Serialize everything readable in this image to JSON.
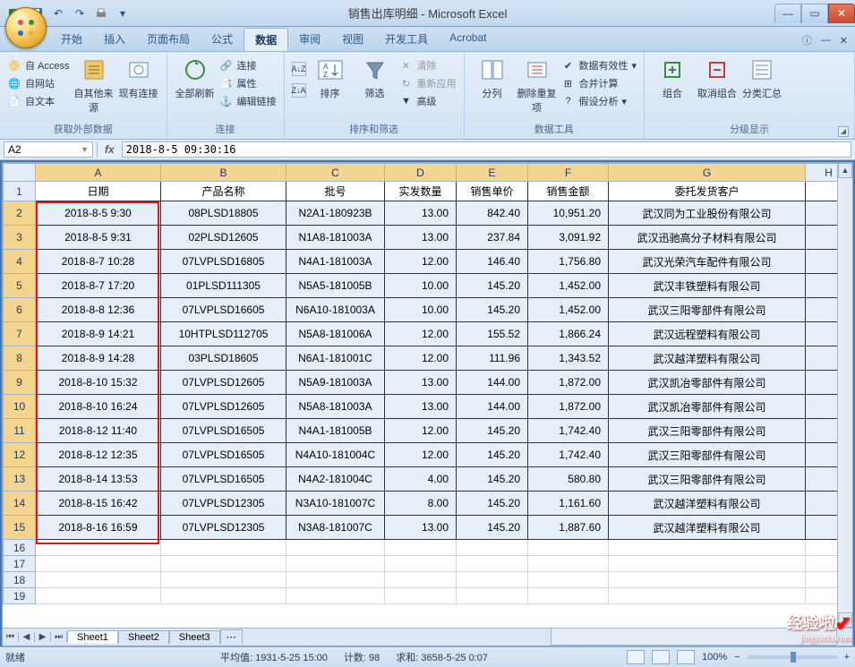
{
  "window": {
    "title": "销售出库明细 - Microsoft Excel"
  },
  "tabs": [
    "开始",
    "插入",
    "页面布局",
    "公式",
    "数据",
    "审阅",
    "视图",
    "开发工具",
    "Acrobat"
  ],
  "activeTab": "数据",
  "ribbon": {
    "g1": {
      "label": "获取外部数据",
      "access": "自 Access",
      "web": "自网站",
      "text": "自文本",
      "other": "自其他来源",
      "existing": "现有连接"
    },
    "g2": {
      "label": "连接",
      "refresh": "全部刷新",
      "conn": "连接",
      "prop": "属性",
      "editlink": "编辑链接"
    },
    "g3": {
      "label": "排序和筛选",
      "sort": "排序",
      "filter": "筛选",
      "clear": "清除",
      "reapply": "重新应用",
      "advanced": "高级"
    },
    "g4": {
      "label": "数据工具",
      "t2c": "分列",
      "dedup": "删除重复项",
      "valid": "数据有效性",
      "consol": "合并计算",
      "whatif": "假设分析"
    },
    "g5": {
      "label": "分级显示",
      "group": "组合",
      "ungroup": "取消组合",
      "subtotal": "分类汇总"
    }
  },
  "formula": {
    "namebox": "A2",
    "value": "2018-8-5  09:30:16"
  },
  "cols": [
    "A",
    "B",
    "C",
    "D",
    "E",
    "F",
    "G",
    "H"
  ],
  "header_row": [
    "日期",
    "产品名称",
    "批号",
    "实发数量",
    "销售单价",
    "销售金额",
    "委托发货客户",
    ""
  ],
  "rows": [
    [
      "2018-8-5 9:30",
      "08PLSD18805",
      "N2A1-180923B",
      "13.00",
      "842.40",
      "10,951.20",
      "武汉同为工业股份有限公司"
    ],
    [
      "2018-8-5 9:31",
      "02PLSD12605",
      "N1A8-181003A",
      "13.00",
      "237.84",
      "3,091.92",
      "武汉迅驰高分子材料有限公司"
    ],
    [
      "2018-8-7 10:28",
      "07LVPLSD16805",
      "N4A1-181003A",
      "12.00",
      "146.40",
      "1,756.80",
      "武汉光荣汽车配件有限公司"
    ],
    [
      "2018-8-7 17:20",
      "01PLSD111305",
      "N5A5-181005B",
      "10.00",
      "145.20",
      "1,452.00",
      "武汉丰铁塑料有限公司"
    ],
    [
      "2018-8-8 12:36",
      "07LVPLSD16605",
      "N6A10-181003A",
      "10.00",
      "145.20",
      "1,452.00",
      "武汉三阳零部件有限公司"
    ],
    [
      "2018-8-9 14:21",
      "10HTPLSD112705",
      "N5A8-181006A",
      "12.00",
      "155.52",
      "1,866.24",
      "武汉远程塑料有限公司"
    ],
    [
      "2018-8-9 14:28",
      "03PLSD18605",
      "N6A1-181001C",
      "12.00",
      "111.96",
      "1,343.52",
      "武汉越洋塑料有限公司"
    ],
    [
      "2018-8-10 15:32",
      "07LVPLSD12605",
      "N5A9-181003A",
      "13.00",
      "144.00",
      "1,872.00",
      "武汉凯冶零部件有限公司"
    ],
    [
      "2018-8-10 16:24",
      "07LVPLSD12605",
      "N5A8-181003A",
      "13.00",
      "144.00",
      "1,872.00",
      "武汉凯冶零部件有限公司"
    ],
    [
      "2018-8-12 11:40",
      "07LVPLSD16505",
      "N4A1-181005B",
      "12.00",
      "145.20",
      "1,742.40",
      "武汉三阳零部件有限公司"
    ],
    [
      "2018-8-12 12:35",
      "07LVPLSD16505",
      "N4A10-181004C",
      "12.00",
      "145.20",
      "1,742.40",
      "武汉三阳零部件有限公司"
    ],
    [
      "2018-8-14 13:53",
      "07LVPLSD16505",
      "N4A2-181004C",
      "4.00",
      "145.20",
      "580.80",
      "武汉三阳零部件有限公司"
    ],
    [
      "2018-8-15 16:42",
      "07LVPLSD12305",
      "N3A10-181007C",
      "8.00",
      "145.20",
      "1,161.60",
      "武汉越洋塑料有限公司"
    ],
    [
      "2018-8-16 16:59",
      "07LVPLSD12305",
      "N3A8-181007C",
      "13.00",
      "145.20",
      "1,887.60",
      "武汉越洋塑料有限公司"
    ]
  ],
  "sheets": [
    "Sheet1",
    "Sheet2",
    "Sheet3"
  ],
  "status": {
    "ready": "就绪",
    "avg_label": "平均值:",
    "avg_val": "1931-5-25 15:00",
    "count_label": "计数:",
    "count_val": "98",
    "sum_label": "求和:",
    "sum_val": "3658-5-25 0:07",
    "zoom": "100%"
  },
  "watermark": {
    "name": "经验啦",
    "url": "jingyanla.com"
  }
}
